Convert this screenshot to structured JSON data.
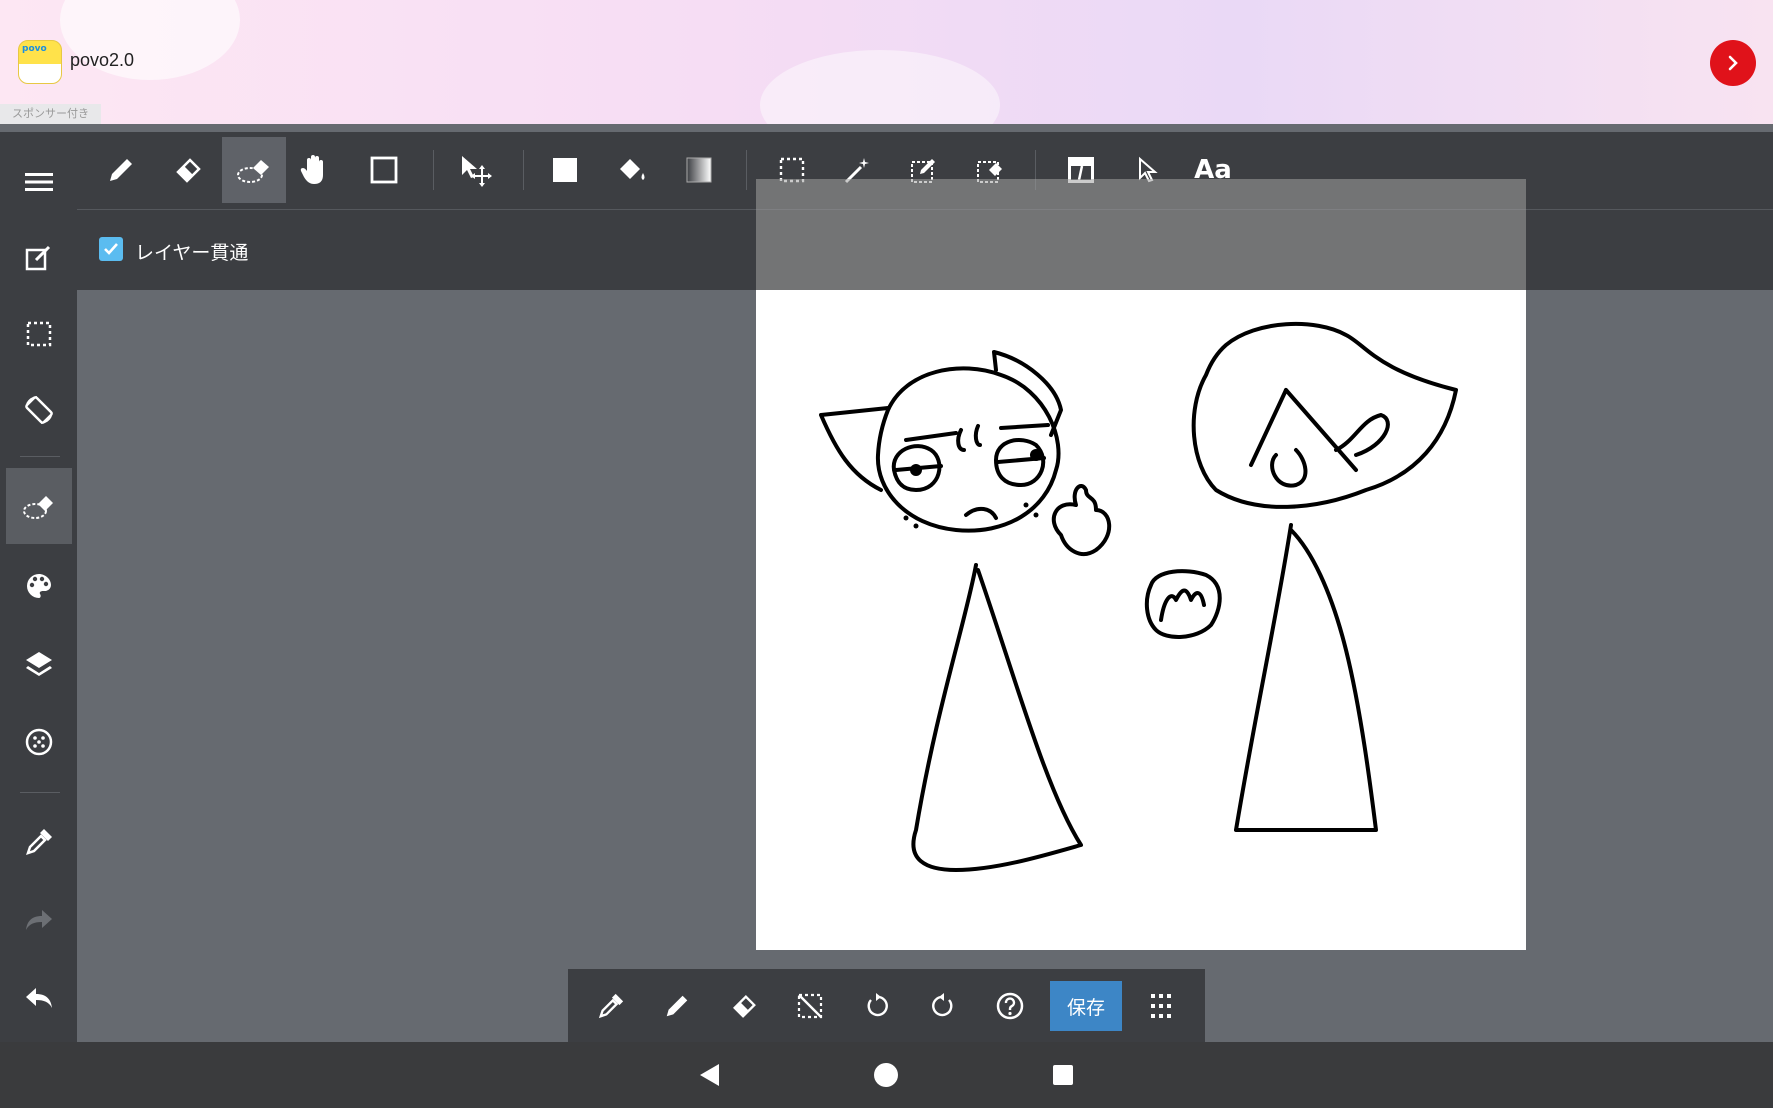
{
  "ad": {
    "title": "povo2.0",
    "sponsored": "スポンサー付き",
    "logo_text": "povo",
    "go_icon": "chevron-right-icon",
    "brand_color": "#e0121a"
  },
  "toolbar": {
    "tools": [
      {
        "name": "pen-tool",
        "icon": "pencil-icon"
      },
      {
        "name": "eraser-tool",
        "icon": "eraser-icon"
      },
      {
        "name": "selection-eraser-tool",
        "icon": "selection-eraser-icon",
        "active": true
      },
      {
        "name": "hand-tool",
        "icon": "hand-icon"
      },
      {
        "name": "shape-tool",
        "icon": "square-outline-icon"
      },
      {
        "name": "move-tool",
        "icon": "move-arrow-icon"
      },
      {
        "name": "fill-rect-tool",
        "icon": "filled-square-icon"
      },
      {
        "name": "bucket-tool",
        "icon": "paint-bucket-icon"
      },
      {
        "name": "gradient-tool",
        "icon": "gradient-icon"
      },
      {
        "name": "select-rect-tool",
        "icon": "marquee-icon"
      },
      {
        "name": "magic-wand-tool",
        "icon": "magic-wand-icon"
      },
      {
        "name": "select-pen-tool",
        "icon": "select-pen-icon"
      },
      {
        "name": "select-eraser-tool",
        "icon": "select-eraser-icon"
      },
      {
        "name": "frame-tool",
        "icon": "frame-divide-icon"
      },
      {
        "name": "operation-tool",
        "icon": "cursor-icon"
      }
    ],
    "text_tool_label": "Aa"
  },
  "options": {
    "layer_through_label": "レイヤー貫通",
    "layer_through_checked": true,
    "check_color": "#5bbcf0"
  },
  "sidebar": {
    "items": [
      {
        "name": "menu",
        "icon": "hamburger-menu-icon"
      },
      {
        "name": "edit",
        "icon": "edit-icon"
      },
      {
        "name": "selection",
        "icon": "marquee-icon"
      },
      {
        "name": "rotate-view",
        "icon": "rotate-screen-icon"
      },
      {
        "name": "selection-eraser",
        "icon": "selection-eraser-icon",
        "active": true
      },
      {
        "name": "color",
        "icon": "palette-icon"
      },
      {
        "name": "layers",
        "icon": "layers-icon"
      },
      {
        "name": "materials",
        "icon": "material-icon"
      },
      {
        "name": "eyedropper",
        "icon": "eyedropper-icon"
      },
      {
        "name": "redo",
        "icon": "redo-icon"
      },
      {
        "name": "undo",
        "icon": "undo-icon"
      }
    ]
  },
  "bottom_toolbar": {
    "items": [
      {
        "name": "eyedropper",
        "icon": "eyedropper-icon"
      },
      {
        "name": "pen",
        "icon": "pencil-icon"
      },
      {
        "name": "eraser",
        "icon": "eraser-icon"
      },
      {
        "name": "deselect",
        "icon": "deselect-icon"
      },
      {
        "name": "undo",
        "icon": "rotate-left-icon"
      },
      {
        "name": "redo",
        "icon": "rotate-right-icon"
      },
      {
        "name": "help",
        "icon": "help-icon"
      }
    ],
    "save_label": "保存",
    "save_color": "#3d86c6",
    "more_icon": "grid-dots-icon"
  },
  "navigation": {
    "back_icon": "back-triangle-icon",
    "home_icon": "home-circle-icon",
    "recents_icon": "recents-square-icon"
  },
  "canvas": {
    "content": "drawing-sketch-two-characters"
  }
}
